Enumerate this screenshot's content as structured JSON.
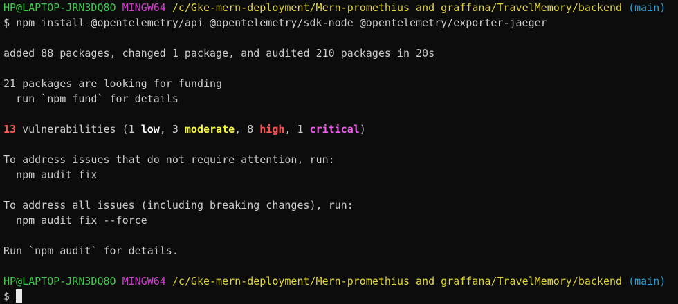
{
  "prompt": {
    "user_host": "HP@LAPTOP-JRN3DQ8O",
    "shell": "MINGW64",
    "path": "/c/Gke-mern-deployment/Mern-promethius and graffana/TravelMemory/backend",
    "branch": "(main)",
    "symbol": "$"
  },
  "command": "npm install @opentelemetry/api @opentelemetry/sdk-node @opentelemetry/exporter-jaeger",
  "output": {
    "added": "added 88 packages, changed 1 package, and audited 210 packages in 20s",
    "funding_1": "21 packages are looking for funding",
    "funding_2": "  run `npm fund` for details",
    "vuln": {
      "count": "13",
      "text_1": " vulnerabilities (1 ",
      "low": "low",
      "text_2": ", 3 ",
      "moderate": "moderate",
      "text_3": ", 8 ",
      "high": "high",
      "text_4": ", 1 ",
      "critical": "critical",
      "text_5": ")"
    },
    "address_1": "To address issues that do not require attention, run:",
    "fix_1": "  npm audit fix",
    "address_2": "To address all issues (including breaking changes), run:",
    "fix_2": "  npm audit fix --force",
    "audit": "Run `npm audit` for details."
  },
  "colors": {
    "background": "#0c0c0c",
    "text": "#cccccc",
    "user_host": "#3ec74a",
    "shell": "#d13ecb",
    "path": "#e1d636",
    "branch": "#2b9fd3"
  }
}
